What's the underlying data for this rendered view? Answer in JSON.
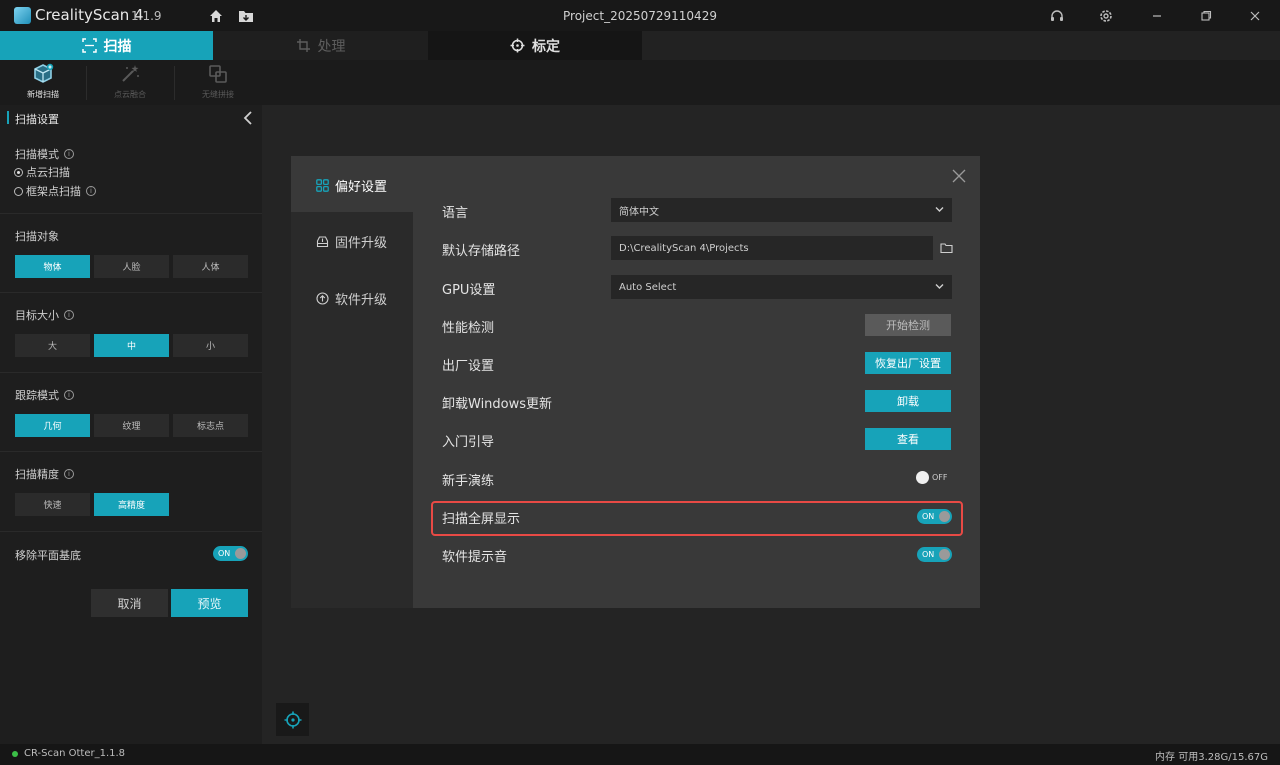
{
  "app": {
    "name": "CrealityScan 4",
    "version": "1.1.9",
    "project_title": "Project_20250729110429"
  },
  "tabs": [
    {
      "label": "扫描",
      "icon": "scan-icon"
    },
    {
      "label": "处理",
      "icon": "crop-icon"
    },
    {
      "label": "标定",
      "icon": "target-icon"
    }
  ],
  "toolbar": {
    "items": [
      {
        "label": "新增扫描",
        "icon": "add-scan-cube-icon"
      },
      {
        "label": "点云融合",
        "icon": "wand-icon"
      },
      {
        "label": "无缝拼接",
        "icon": "merge-icon"
      }
    ]
  },
  "scan_settings": {
    "title": "扫描设置",
    "scan_mode": {
      "label": "扫描模式",
      "options": [
        "点云扫描",
        "框架点扫描"
      ],
      "selected": "点云扫描"
    },
    "scan_object": {
      "label": "扫描对象",
      "options": [
        "物体",
        "人脸",
        "人体"
      ],
      "selected": "物体"
    },
    "target_size": {
      "label": "目标大小",
      "options": [
        "大",
        "中",
        "小"
      ],
      "selected": "中"
    },
    "tracking_mode": {
      "label": "跟踪模式",
      "options": [
        "几何",
        "纹理",
        "标志点"
      ],
      "selected": "几何"
    },
    "scan_precision": {
      "label": "扫描精度",
      "options": [
        "快速",
        "高精度"
      ],
      "selected": "高精度"
    },
    "remove_plane": {
      "label": "移除平面基底",
      "state": "ON"
    },
    "cancel_label": "取消",
    "preview_label": "预览"
  },
  "status": {
    "device": "CR-Scan Otter_1.1.8",
    "memory": "内存 可用3.28G/15.67G"
  },
  "preferences": {
    "sidebar": [
      {
        "label": "偏好设置",
        "icon": "grid-icon"
      },
      {
        "label": "固件升级",
        "icon": "firmware-icon"
      },
      {
        "label": "软件升级",
        "icon": "software-upgrade-icon"
      }
    ],
    "selected_section": "偏好设置",
    "rows": {
      "language": {
        "label": "语言",
        "value": "简体中文"
      },
      "storage": {
        "label": "默认存储路径",
        "value": "D:\\CrealityScan 4\\Projects"
      },
      "gpu": {
        "label": "GPU设置",
        "value": "Auto Select"
      },
      "perf": {
        "label": "性能检测",
        "button": "开始检测"
      },
      "factory": {
        "label": "出厂设置",
        "button": "恢复出厂设置"
      },
      "uninstall_updates": {
        "label": "卸载Windows更新",
        "button": "卸载"
      },
      "guide": {
        "label": "入门引导",
        "button": "查看"
      },
      "tutorial": {
        "label": "新手演练",
        "state": "OFF"
      },
      "fullscreen": {
        "label": "扫描全屏显示",
        "state": "ON"
      },
      "sound": {
        "label": "软件提示音",
        "state": "ON"
      }
    }
  },
  "colors": {
    "accent": "#17a3b9",
    "highlight_border": "#e84a45",
    "status_ok": "#3bbf47"
  }
}
